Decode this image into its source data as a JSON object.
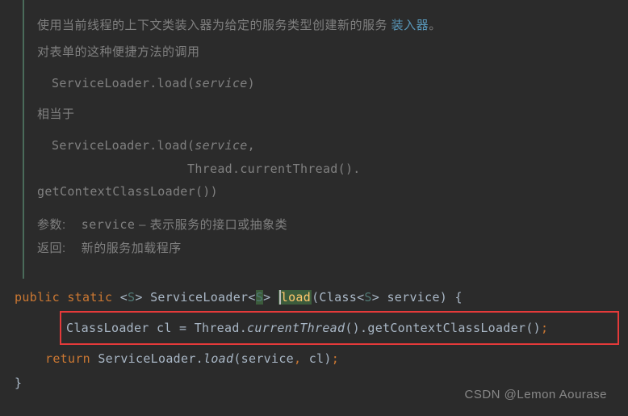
{
  "doc": {
    "line1_pre": "使用当前线程的上下文类装入器为给定的服务类型创建新的服务 ",
    "line1_link": "装入器",
    "line1_post": "。",
    "line2": "对表单的这种便捷方法的调用",
    "code1_part1": "ServiceLoader.load(",
    "code1_service": "service",
    "code1_part2": ")",
    "line3": "相当于",
    "code2_line1_part1": "ServiceLoader.load(",
    "code2_line1_service": "service",
    "code2_line1_part3": ",",
    "code2_line2": "Thread.currentThread().",
    "code2_line3": "getContextClassLoader())",
    "params_label": "参数:",
    "params_name": "service",
    "params_dash": " – ",
    "params_desc": "表示服务的接口或抽象类",
    "returns_label": "返回:",
    "returns_desc": "新的服务加载程序"
  },
  "code": {
    "kw_public": "public",
    "kw_static": "static",
    "lt1": "<",
    "generic_s1": "S",
    "gt1": ">",
    "type_serviceloader": "ServiceLoader",
    "lt2": "<",
    "generic_s2": "S",
    "gt2": ">",
    "method_load": "load",
    "paren_open1": "(",
    "type_class": "Class",
    "lt3": "<",
    "generic_s3": "S",
    "gt3": ">",
    "param_service": "service",
    "paren_close1": ")",
    "brace_open": "{",
    "type_classloader": "ClassLoader",
    "var_cl": "cl",
    "eq": "=",
    "thread": "Thread",
    "dot1": ".",
    "currentThread": "currentThread",
    "parens1": "()",
    "dot2": ".",
    "getContextClassLoader": "getContextClassLoader",
    "parens2": "()",
    "semi1": ";",
    "kw_return": "return",
    "sl2": "ServiceLoader",
    "dot3": ".",
    "load2": "load",
    "paren_open2": "(",
    "arg_service": "service",
    "comma": ",",
    "arg_cl": "cl",
    "paren_close2": ")",
    "semi2": ";",
    "brace_close": "}"
  },
  "watermark": "CSDN @Lemon Aourase"
}
